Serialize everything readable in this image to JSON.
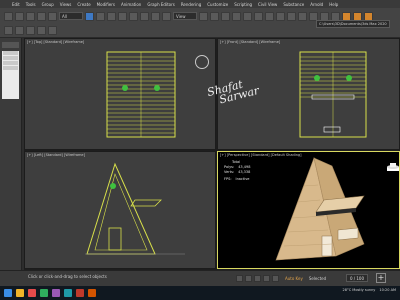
{
  "menubar": {
    "items": [
      "Edit",
      "Tools",
      "Group",
      "Views",
      "Create",
      "Modifiers",
      "Animation",
      "Graph Editors",
      "Rendering",
      "Customize",
      "Scripting",
      "Civil View",
      "Substance",
      "Arnold",
      "Help"
    ]
  },
  "toolbar": {
    "selection_filter": "All",
    "view_select": "View",
    "path": "C:\\Users\\3D\\Documents\\3ds Max 2020"
  },
  "viewports": [
    {
      "label": "[+] [Top] [Standard] [Wireframe]"
    },
    {
      "label": "[+] [Front] [Standard] [Wireframe]"
    },
    {
      "label": "[+] [Left] [Standard] [Wireframe]"
    },
    {
      "label": "[+] [Perspective] [Standard] [Default Shading]"
    }
  ],
  "stats": {
    "header": "Total",
    "polys_label": "Polys:",
    "polys_value": "43,498",
    "verts_label": "Verts:",
    "verts_value": "43,338",
    "fps_label": "FPS:",
    "fps_value": "Inactive"
  },
  "signature": {
    "line1": "Shafat",
    "line2": "Sarwar"
  },
  "status": {
    "text": "Click or click-and-drag to select objects",
    "frame": "0 / 100",
    "autokey": "Auto Key",
    "selected": "Selected"
  },
  "taskbar": {
    "time": "10:20 AM",
    "weather": "28°C  Mostly sunny"
  },
  "colors": {
    "wire": "#d8e04a",
    "wire_green": "#3fc13f",
    "wood": "#d8b98c",
    "wood_dark": "#a98a5f"
  }
}
